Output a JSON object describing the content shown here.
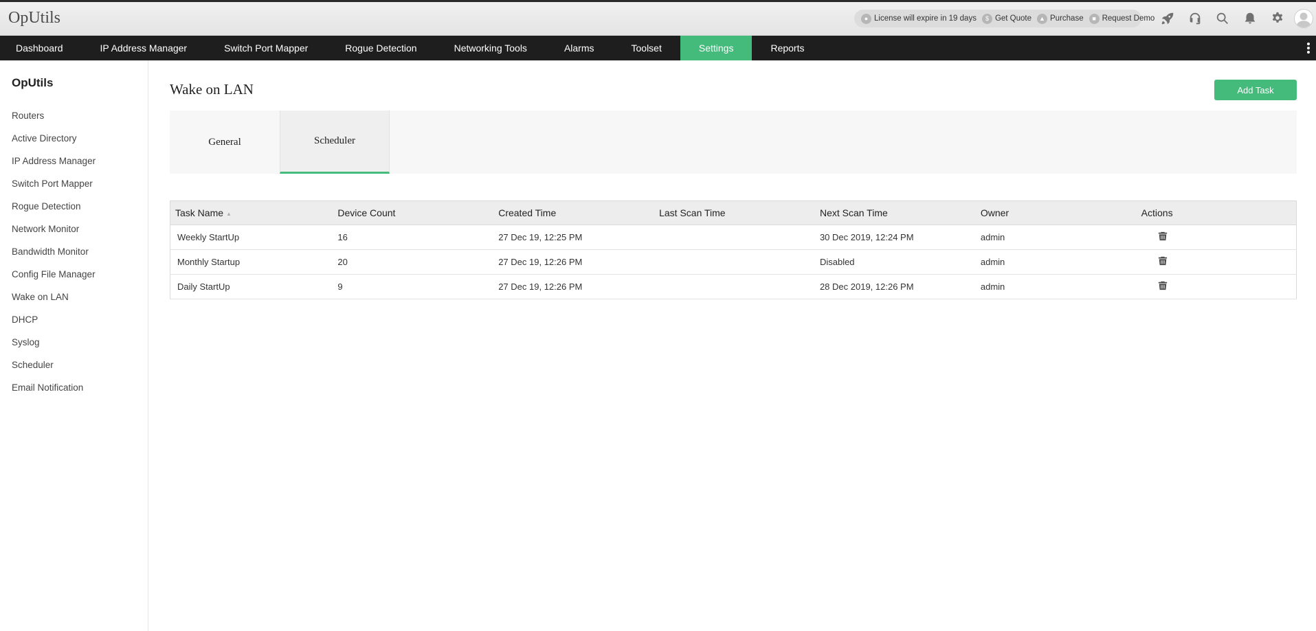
{
  "app": {
    "brand": "OpUtils"
  },
  "license": {
    "expiry_text": "License will expire in 19 days",
    "get_quote": "Get Quote",
    "purchase": "Purchase",
    "request_demo": "Request Demo"
  },
  "top_icons": [
    "rocket-icon",
    "headset-icon",
    "search-icon",
    "bell-icon",
    "gear-icon",
    "user-avatar-icon"
  ],
  "nav": {
    "items": [
      {
        "label": "Dashboard",
        "active": false
      },
      {
        "label": "IP Address Manager",
        "active": false
      },
      {
        "label": "Switch Port Mapper",
        "active": false
      },
      {
        "label": "Rogue Detection",
        "active": false
      },
      {
        "label": "Networking Tools",
        "active": false
      },
      {
        "label": "Alarms",
        "active": false
      },
      {
        "label": "Toolset",
        "active": false
      },
      {
        "label": "Settings",
        "active": true
      },
      {
        "label": "Reports",
        "active": false
      }
    ]
  },
  "sidebar": {
    "title": "OpUtils",
    "items": [
      {
        "label": "Routers"
      },
      {
        "label": "Active Directory"
      },
      {
        "label": "IP Address Manager"
      },
      {
        "label": "Switch Port Mapper"
      },
      {
        "label": "Rogue Detection"
      },
      {
        "label": "Network Monitor"
      },
      {
        "label": "Bandwidth Monitor"
      },
      {
        "label": "Config File Manager"
      },
      {
        "label": "Wake on LAN"
      },
      {
        "label": "DHCP"
      },
      {
        "label": "Syslog"
      },
      {
        "label": "Scheduler"
      },
      {
        "label": "Email Notification"
      }
    ]
  },
  "main": {
    "title": "Wake on LAN",
    "add_task_label": "Add Task",
    "tabs": [
      {
        "label": "General",
        "active": false
      },
      {
        "label": "Scheduler",
        "active": true
      }
    ],
    "table": {
      "headers": {
        "task_name": "Task Name",
        "device_count": "Device Count",
        "created_time": "Created Time",
        "last_scan_time": "Last Scan Time",
        "next_scan_time": "Next Scan Time",
        "owner": "Owner",
        "actions": "Actions"
      },
      "rows": [
        {
          "task_name": "Weekly StartUp",
          "device_count": "16",
          "created_time": "27 Dec 19, 12:25 PM",
          "last_scan_time": "",
          "next_scan_time": "30 Dec 2019, 12:24 PM",
          "owner": "admin"
        },
        {
          "task_name": "Monthly Startup",
          "device_count": "20",
          "created_time": "27 Dec 19, 12:26 PM",
          "last_scan_time": "",
          "next_scan_time": "Disabled",
          "owner": "admin"
        },
        {
          "task_name": "Daily StartUp",
          "device_count": "9",
          "created_time": "27 Dec 19, 12:26 PM",
          "last_scan_time": "",
          "next_scan_time": "28 Dec 2019, 12:26 PM",
          "owner": "admin"
        }
      ]
    }
  },
  "colors": {
    "accent_green": "#44ba7b",
    "nav_background": "#1e1e1e",
    "topbar_background": "#e8e8e8"
  }
}
